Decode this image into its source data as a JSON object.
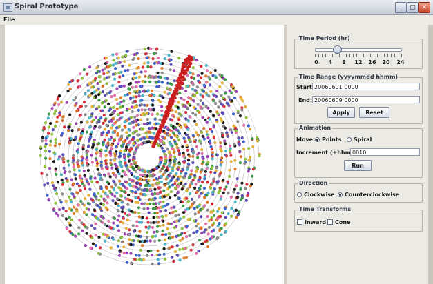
{
  "window": {
    "title": "Spiral Prototype"
  },
  "menu": {
    "file": "File"
  },
  "time_period": {
    "title": "Time Period (hr)",
    "ticks": [
      "0",
      "4",
      "8",
      "12",
      "16",
      "20",
      "24"
    ],
    "slider_value_hr": 6
  },
  "time_range": {
    "title": "Time Range (yyyymmdd hhmm)",
    "start_label": "Start:",
    "start_value": "20060601 0000",
    "end_label": "End:",
    "end_value": "20060609 0000",
    "apply": "Apply",
    "reset": "Reset"
  },
  "animation": {
    "title": "Animation",
    "move_label": "Move:",
    "points": "Points",
    "spiral": "Spiral",
    "move_selected": "Points",
    "increment_label": "Increment (±hhmm):",
    "increment_value": "0010",
    "run": "Run"
  },
  "direction": {
    "title": "Direction",
    "clockwise": "Clockwise",
    "counterclockwise": "Counterclockwise",
    "selected": "Counterclockwise"
  },
  "time_transforms": {
    "title": "Time Transforms",
    "inward": "Inward",
    "inward_checked": false,
    "cone": "Cone",
    "cone_checked": false
  },
  "colors": {
    "palette": [
      "#d6333f",
      "#e2b23a",
      "#3e9a4a",
      "#3a64c9",
      "#9b44b2",
      "#1b1b1b",
      "#e06fa8",
      "#4fb3c7",
      "#8fbf3c",
      "#8a8a8a",
      "#d97a2b",
      "#5a4fb3"
    ],
    "highlight": "#cc1f1f"
  }
}
